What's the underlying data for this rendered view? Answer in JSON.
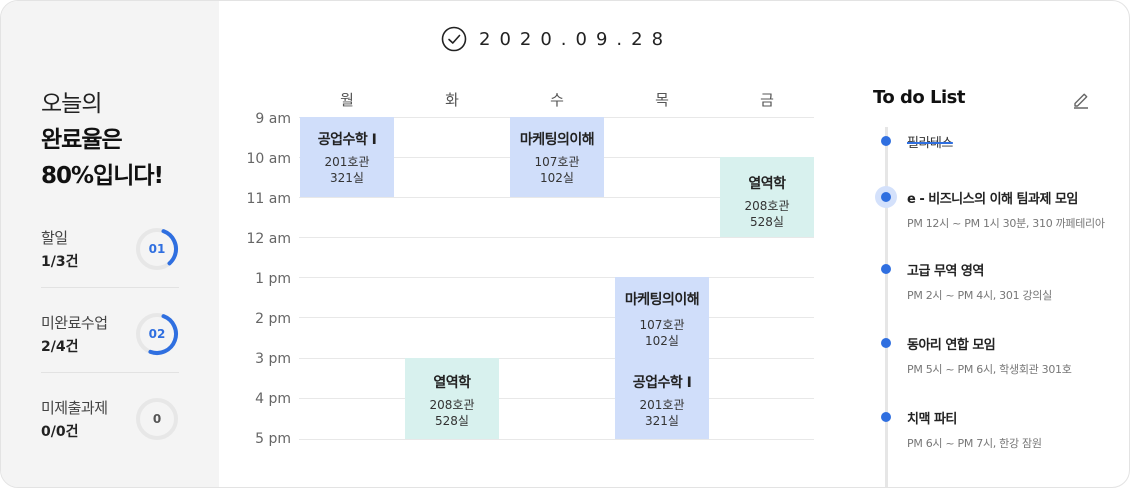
{
  "date": "2020.09.28",
  "sidebar": {
    "headline": [
      "오늘의",
      "완료율은",
      "80%입니다!"
    ],
    "stats": [
      {
        "label": "할일",
        "count": "1/3건",
        "badge": "01",
        "progress": 0.33,
        "color": "#2f6fe0"
      },
      {
        "label": "미완료수업",
        "count": "2/4건",
        "badge": "02",
        "progress": 0.5,
        "color": "#2f6fe0"
      },
      {
        "label": "미제출과제",
        "count": "0/0건",
        "badge": "0",
        "progress": 0,
        "color": "#555555"
      }
    ]
  },
  "timetable": {
    "days": [
      "월",
      "화",
      "수",
      "목",
      "금"
    ],
    "hours": [
      "9 am",
      "10 am",
      "11 am",
      "12 am",
      "1 pm",
      "2 pm",
      "3 pm",
      "4 pm",
      "5 pm"
    ],
    "classes": [
      {
        "name": "공업수학 I",
        "building": "201호관",
        "room": "321실",
        "color": "blue"
      },
      {
        "name": "마케팅의이해",
        "building": "107호관",
        "room": "102실",
        "color": "blue"
      },
      {
        "name": "열역학",
        "building": "208호관",
        "room": "528실",
        "color": "mint"
      },
      {
        "name": "마케팅의이해",
        "building": "107호관",
        "room": "102실",
        "color": "blue"
      },
      {
        "name": "열역학",
        "building": "208호관",
        "room": "528실",
        "color": "mint"
      },
      {
        "name": "공업수학 I",
        "building": "201호관",
        "room": "321실",
        "color": "blue"
      }
    ]
  },
  "todo": {
    "title": "To do List",
    "items": [
      {
        "name": "필라테스",
        "time": "",
        "done": true
      },
      {
        "name": "e - 비즈니스의 이해 팀과제 모임",
        "time": "PM 12시 ~ PM 1시 30분, 310 까페테리아",
        "active": true
      },
      {
        "name": "고급 무역 영역",
        "time": "PM 2시 ~ PM 4시, 301 강의실"
      },
      {
        "name": "동아리 연합 모임",
        "time": "PM 5시 ~ PM 6시, 학생회관 301호"
      },
      {
        "name": "치맥 파티",
        "time": "PM 6시 ~ PM 7시, 한강 잠원"
      }
    ]
  }
}
